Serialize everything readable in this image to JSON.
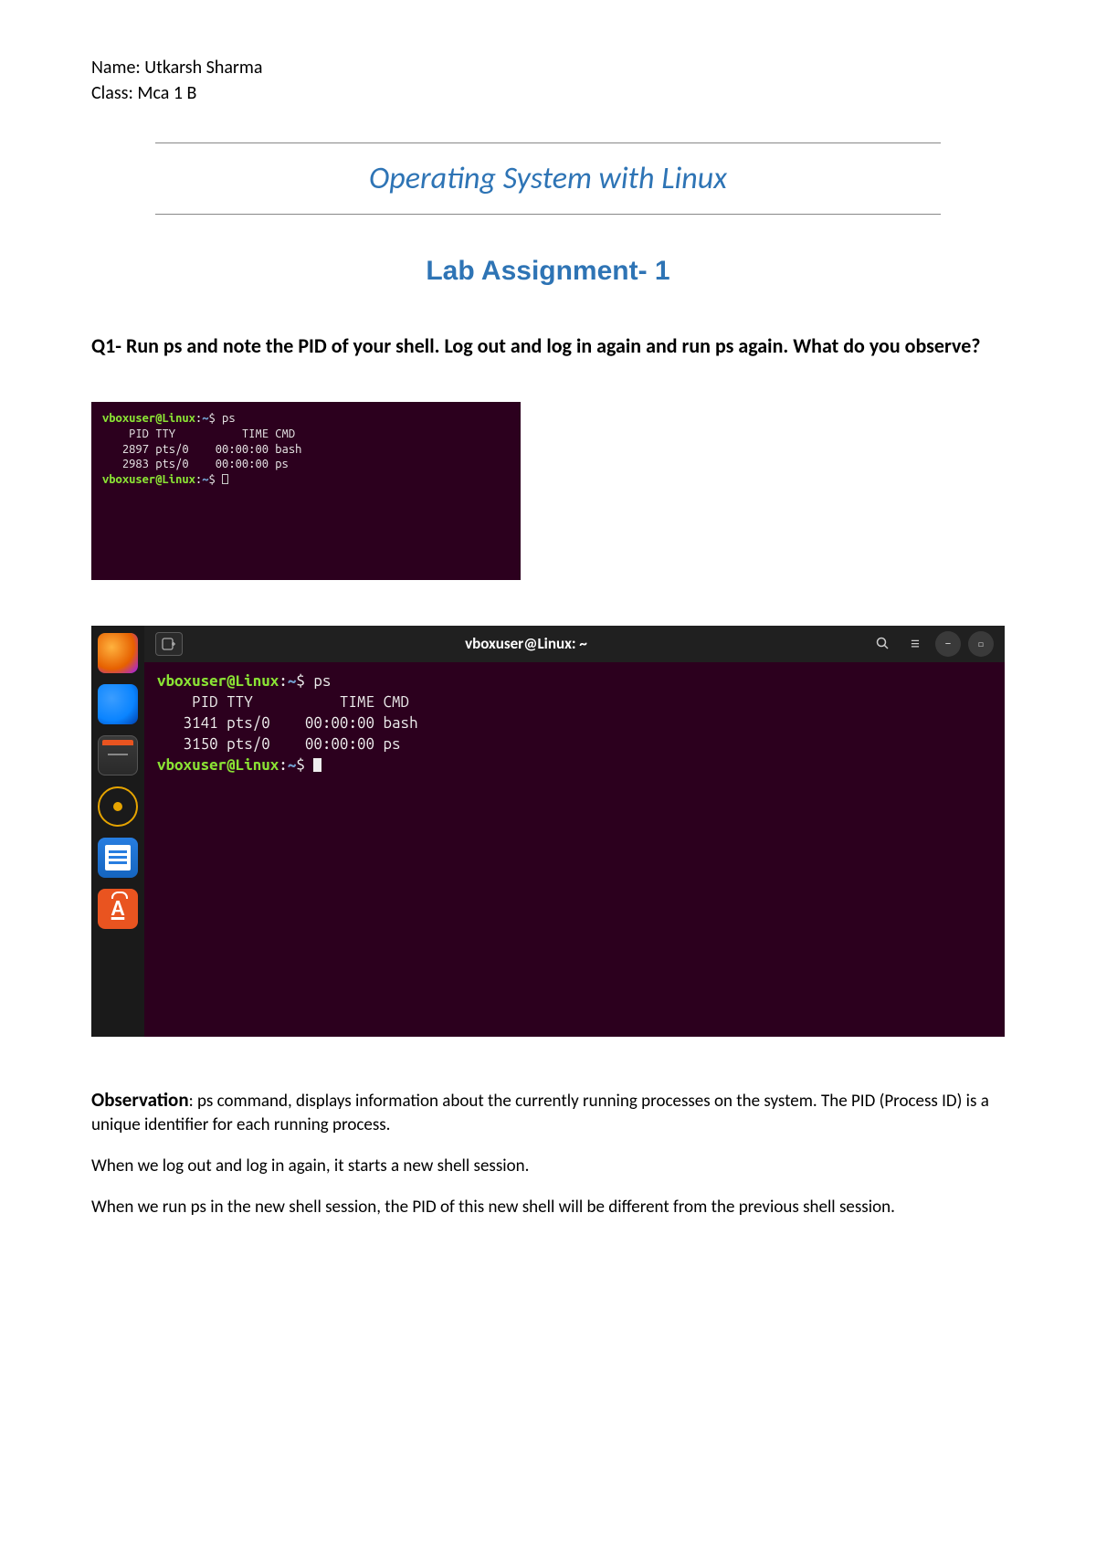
{
  "header": {
    "name_label": "Name: Utkarsh Sharma",
    "class_label": "Class: Mca 1 B"
  },
  "doc_title": "Operating System with Linux",
  "lab_title": "Lab Assignment- 1",
  "question": {
    "label": "Q1-",
    "text": "  Run ps and note the PID of your shell. Log out and log in again and run ps again. What do you observe?"
  },
  "terminal1": {
    "user": "vboxuser@Linux",
    "path": "~",
    "cmd": "ps",
    "output": "    PID TTY          TIME CMD\n   2897 pts/0    00:00:00 bash\n   2983 pts/0    00:00:00 ps"
  },
  "terminal2": {
    "title": "vboxuser@Linux: ~",
    "user": "vboxuser@Linux",
    "path": "~",
    "cmd": "ps",
    "output": "    PID TTY          TIME CMD\n   3141 pts/0    00:00:00 bash\n   3150 pts/0    00:00:00 ps"
  },
  "dock_items": [
    "firefox",
    "thunderbird",
    "files",
    "rhythmbox",
    "writer",
    "software"
  ],
  "icons": {
    "newtab": "⊕",
    "search": "Q",
    "menu": "≡",
    "minimize": "–",
    "maximize": "▢"
  },
  "observation": {
    "label": "Observation",
    "p1": ":  ps command, displays information about the currently running processes on the system. The PID (Process ID) is a unique identifier for each running process.",
    "p2": "When we log out and log in again, it starts a new shell session.",
    "p3": "When we run ps in the new shell session, the PID of this new shell will be different from the previous shell session."
  }
}
